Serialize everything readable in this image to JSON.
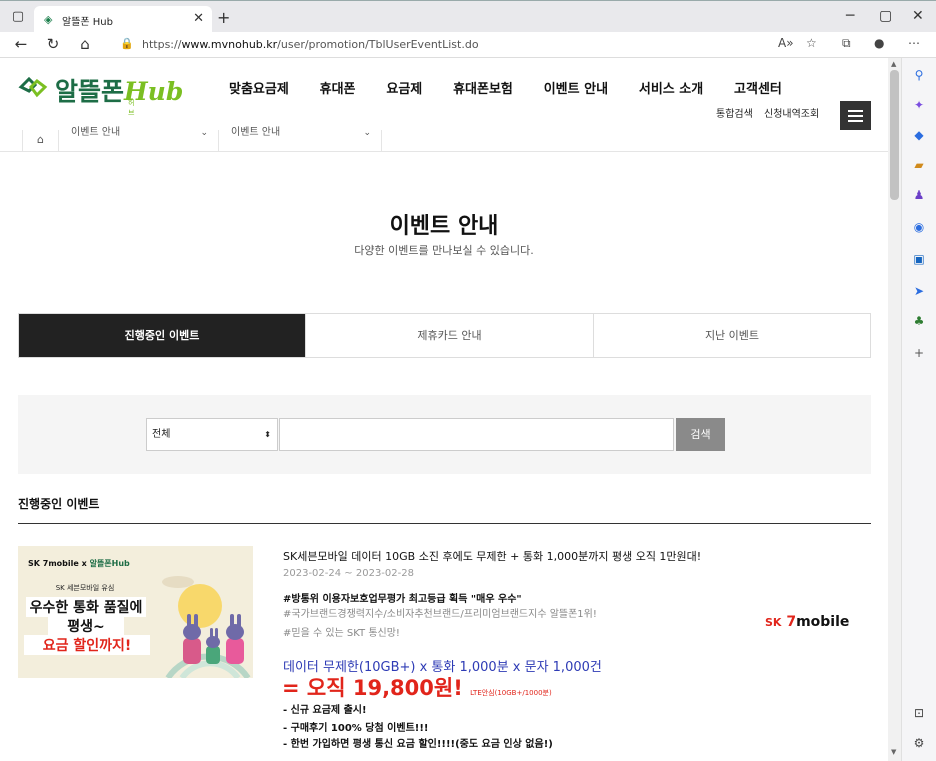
{
  "browser": {
    "tab_title": "알뜰폰 Hub",
    "url_host": "www.mvnohub.kr",
    "url_prefix": "https://",
    "url_path": "/user/promotion/TblUserEventList.do"
  },
  "header": {
    "logo_text": "알뜰폰",
    "logo_hub": "Hub",
    "logo_sub": "허브",
    "nav": [
      "맞춤요금제",
      "휴대폰",
      "요금제",
      "휴대폰보험",
      "이벤트 안내",
      "서비스 소개",
      "고객센터"
    ],
    "util": [
      "통합검색",
      "신청내역조회"
    ]
  },
  "breadcrumb": {
    "level1": "이벤트 안내",
    "level2": "이벤트 안내"
  },
  "page": {
    "title": "이벤트 안내",
    "desc": "다양한 이벤트를 만나보실 수 있습니다."
  },
  "tabs": [
    "진행중인 이벤트",
    "제휴카드 안내",
    "지난 이벤트"
  ],
  "search": {
    "select_value": "전체",
    "input_value": "",
    "button": "검색"
  },
  "section_title": "진행중인 이벤트",
  "event": {
    "banner": {
      "brand_sk": "SK",
      "brand_7": "7mobile",
      "brand_x": "x",
      "brand_hub": "알뜰폰Hub",
      "tag": "SK 세븐모바일 유심",
      "line1": "우수한 통화 품질에",
      "line2": "평생~",
      "line3": "요금 할인까지!"
    },
    "title": "SK세븐모바일 데이터 10GB 소진 후에도 무제한 + 통화 1,000분까지 평생 오직 1만원대!",
    "date": "2023-02-24 ~ 2023-02-28",
    "b1": "#방통위 이용자보호업무평가 최고등급 획득 \"매우 우수\"",
    "b2": "#국가브랜드경쟁력지수/소비자추천브랜드/프리미엄브랜드지수 알뜰폰1위!",
    "b3": "#믿을 수 있는 SKT 통신망!",
    "h1": "데이터 무제한(10GB+) x 통화 1,000분 x 문자 1,000건",
    "h2": "= 오직 19,800원!",
    "h2_small": "LTE안심(10GB+/1000분)",
    "list": [
      "- 신규 요금제 출시!",
      "- 구매후기 100% 당첨 이벤트!!!",
      "- 한번 가입하면 평생 통신 요금 할인!!!!(중도 요금 인상 없음!)"
    ],
    "sk_label": "SK",
    "mobile_label": "mobile"
  }
}
